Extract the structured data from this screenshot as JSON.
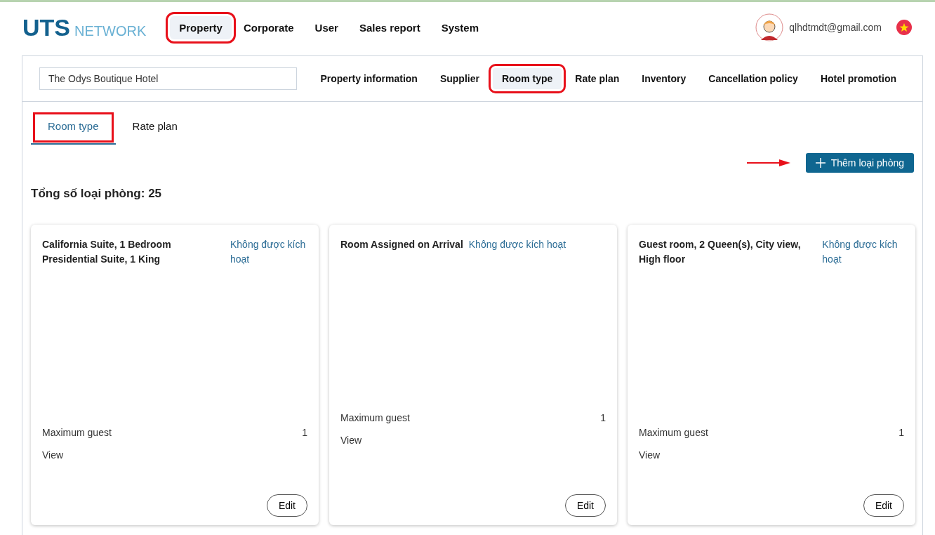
{
  "logo": {
    "main": "UTS",
    "sub": "NETWORK"
  },
  "main_nav": [
    {
      "label": "Property",
      "selected": true,
      "highlighted": true
    },
    {
      "label": "Corporate",
      "selected": false,
      "highlighted": false
    },
    {
      "label": "User",
      "selected": false,
      "highlighted": false
    },
    {
      "label": "Sales report",
      "selected": false,
      "highlighted": false
    },
    {
      "label": "System",
      "selected": false,
      "highlighted": false
    }
  ],
  "user": {
    "email": "qlhdtmdt@gmail.com"
  },
  "property_field": {
    "value": "The Odys Boutique Hotel"
  },
  "property_nav": [
    {
      "label": "Property information",
      "selected": false,
      "highlighted": false
    },
    {
      "label": "Supplier",
      "selected": false,
      "highlighted": false
    },
    {
      "label": "Room type",
      "selected": true,
      "highlighted": true
    },
    {
      "label": "Rate plan",
      "selected": false,
      "highlighted": false
    },
    {
      "label": "Inventory",
      "selected": false,
      "highlighted": false
    },
    {
      "label": "Cancellation policy",
      "selected": false,
      "highlighted": false
    },
    {
      "label": "Hotel promotion",
      "selected": false,
      "highlighted": false
    }
  ],
  "tabs": [
    {
      "label": "Room type",
      "selected": true,
      "highlighted": true
    },
    {
      "label": "Rate plan",
      "selected": false,
      "highlighted": false
    }
  ],
  "add_button": {
    "label": "Thêm loại phòng",
    "arrow": true
  },
  "total": "Tổng số loại phòng: 25",
  "rooms": [
    {
      "name": "California Suite, 1 Bedroom Presidential Suite, 1 King",
      "status": "Không được kích hoạt",
      "guest_label": "Maximum guest",
      "guest_value": "1",
      "view": "View",
      "edit": "Edit"
    },
    {
      "name": "Room Assigned on Arrival",
      "status": "Không được kích hoạt",
      "guest_label": "Maximum guest",
      "guest_value": "1",
      "view": "View",
      "edit": "Edit"
    },
    {
      "name": "Guest room, 2 Queen(s), City view, High floor",
      "status": "Không được kích hoạt",
      "guest_label": "Maximum guest",
      "guest_value": "1",
      "view": "View",
      "edit": "Edit"
    }
  ]
}
